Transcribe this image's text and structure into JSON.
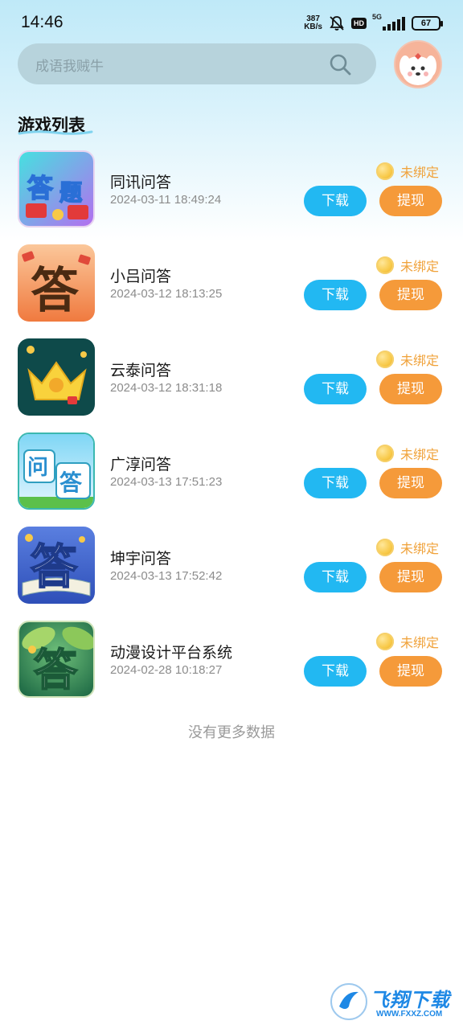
{
  "status_bar": {
    "time": "14:46",
    "net_speed_value": "387",
    "net_speed_unit": "KB/s",
    "hd": "HD",
    "network": "5G",
    "battery": "67"
  },
  "search": {
    "placeholder": "成语我贼牛"
  },
  "section_title": "游戏列表",
  "items": [
    {
      "name": "同讯问答",
      "date": "2024-03-11 18:49:24",
      "bind_status": "未绑定",
      "download_label": "下载",
      "withdraw_label": "提现"
    },
    {
      "name": "小吕问答",
      "date": "2024-03-12 18:13:25",
      "bind_status": "未绑定",
      "download_label": "下载",
      "withdraw_label": "提现"
    },
    {
      "name": "云泰问答",
      "date": "2024-03-12 18:31:18",
      "bind_status": "未绑定",
      "download_label": "下载",
      "withdraw_label": "提现"
    },
    {
      "name": "广淳问答",
      "date": "2024-03-13 17:51:23",
      "bind_status": "未绑定",
      "download_label": "下载",
      "withdraw_label": "提现"
    },
    {
      "name": "坤宇问答",
      "date": "2024-03-13 17:52:42",
      "bind_status": "未绑定",
      "download_label": "下载",
      "withdraw_label": "提现"
    },
    {
      "name": "动漫设计平台系统",
      "date": "2024-02-28 10:18:27",
      "bind_status": "未绑定",
      "download_label": "下载",
      "withdraw_label": "提现"
    }
  ],
  "footer": {
    "no_more": "没有更多数据"
  },
  "watermark": {
    "brand": "飞翔下载",
    "url": "WWW.FXXZ.COM"
  },
  "colors": {
    "download_button": "#22b8f2",
    "withdraw_button": "#f59a3a",
    "bind_status": "#f0a23a"
  }
}
